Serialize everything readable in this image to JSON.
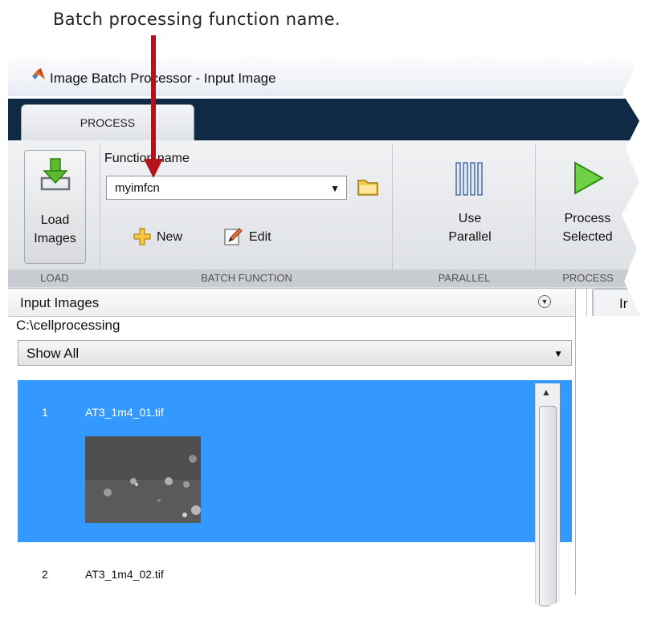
{
  "annotation": {
    "callout": "Batch processing function name."
  },
  "window": {
    "title": "Image Batch Processor - Input Image"
  },
  "tabs": [
    {
      "label": "PROCESS",
      "active": true
    }
  ],
  "ribbon": {
    "load": {
      "button_line1": "Load",
      "button_line2": "Images",
      "group_label": "LOAD"
    },
    "batch_function": {
      "field_label": "Function name",
      "function_value": "myimfcn",
      "new_label": "New",
      "edit_label": "Edit",
      "group_label": "BATCH FUNCTION"
    },
    "parallel": {
      "button_line1": "Use",
      "button_line2": "Parallel",
      "group_label": "PARALLEL"
    },
    "process": {
      "button_line1": "Process",
      "button_line2": "Selected",
      "group_label": "PROCESS"
    }
  },
  "input_panel": {
    "title": "Input Images",
    "folder_path": "C:\\cellprocessing",
    "filter_value": "Show All",
    "items": [
      {
        "index": "1",
        "name": "AT3_1m4_01.tif",
        "selected": true
      },
      {
        "index": "2",
        "name": "AT3_1m4_02.tif",
        "selected": false
      }
    ]
  },
  "right_panel": {
    "tab_label": "Ir"
  },
  "colors": {
    "selection": "#3399ff",
    "tabstrip": "#0f2a44",
    "arrow": "#b3141b"
  },
  "icons": [
    "matlab-icon",
    "load-images-icon",
    "folder-icon",
    "new-plus-icon",
    "edit-pencil-icon",
    "parallel-icon",
    "run-icon",
    "panel-menu-icon",
    "scroll-up-icon"
  ]
}
